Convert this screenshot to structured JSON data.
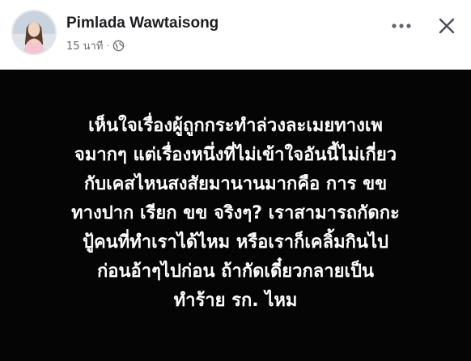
{
  "post": {
    "author": "Pimlada Wawtaisong",
    "time": "15 นาที",
    "separator": "·",
    "privacy_icon": "globe-icon",
    "more_icon": "more-options-icon",
    "close_icon": "close-icon",
    "avatar_icon": "profile-avatar",
    "lines": [
      "เห็นใจเรื่องผู้ถูกกระทำล่วงละเมยทางเพ",
      "จมากๆ แต่เรื่องหนึ่งที่ไม่เข้าใจอันนี้ไม่เกี่ยว",
      "กับเคสไหนสงสัยมานานมากคือ การ ขข",
      "ทางปาก เรียก ขข จริงๆ? เราสามารถกัดกะ",
      "ปู้คนที่ทำเราได้ไหม หรือเราก็เคลิ้มกินไป",
      "ก่อนอ้าๆไปก่อน ถ้ากัดเดี๋ยวกลายเป็น",
      "ทำร้าย รก. ไหม"
    ]
  },
  "colors": {
    "header_bg": "#ffffff",
    "post_bg": "#050505",
    "post_text": "#ffffff",
    "name_text": "#1c1e21",
    "meta_text": "#65676b"
  }
}
